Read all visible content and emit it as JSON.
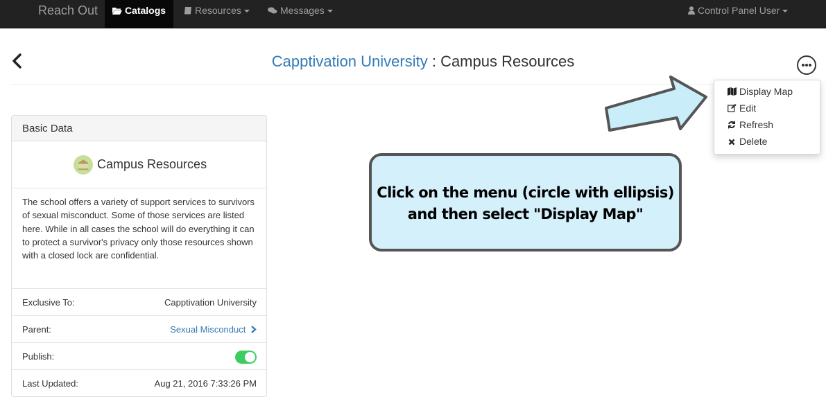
{
  "navbar": {
    "brand": "Reach Out",
    "items": [
      {
        "label": "Catalogs",
        "icon": "folder-open-icon",
        "active": true
      },
      {
        "label": "Resources",
        "icon": "book-icon",
        "dropdown": true
      },
      {
        "label": "Messages",
        "icon": "comments-icon",
        "dropdown": true
      }
    ],
    "user": {
      "label": "Control Panel User",
      "icon": "user-icon"
    }
  },
  "header": {
    "title_link": "Capptivation University",
    "title_separator": " : ",
    "title_rest": "Campus Resources"
  },
  "dropdown_menu": {
    "items": [
      {
        "label": "Display Map",
        "icon": "map-icon"
      },
      {
        "label": "Edit",
        "icon": "edit-icon"
      },
      {
        "label": "Refresh",
        "icon": "refresh-icon"
      },
      {
        "label": "Delete",
        "icon": "times-icon"
      }
    ]
  },
  "panel": {
    "heading": "Basic Data",
    "subtitle": "Campus Resources",
    "description": "The school offers a variety of support services to survivors of sexual misconduct. Some of those services are listed here. While in all cases the school will do everything it can to protect a survivor's privacy only those resources shown with a closed lock are confidential.",
    "rows": [
      {
        "label": "Exclusive To:",
        "value": "Capptivation University"
      },
      {
        "label": "Parent:",
        "value": "Sexual Misconduct"
      },
      {
        "label": "Publish:",
        "value": true
      },
      {
        "label": "Last Updated:",
        "value": "Aug 21, 2016 7:33:26 PM"
      }
    ]
  },
  "callout": {
    "line1": "Click on the menu (circle with ellipsis)",
    "line2": "and then select \"Display Map\""
  },
  "colors": {
    "navbar_bg": "#222222",
    "link": "#337ab7",
    "toggle_on": "#3dcc5f",
    "callout_bg": "#d4f0fa",
    "arrow_fill": "#c9eef9"
  }
}
